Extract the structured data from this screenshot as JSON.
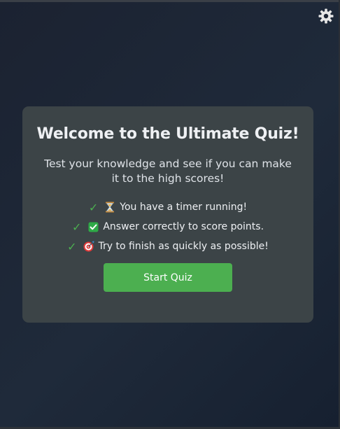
{
  "settings": {
    "icon": "gear-icon",
    "color": "#e6e6e6"
  },
  "card": {
    "title": "Welcome to the Ultimate Quiz!",
    "intro": "Test your knowledge and see if you can make it to the high scores!",
    "features": [
      {
        "icon": "hourglass-icon",
        "text": "You have a timer running!"
      },
      {
        "icon": "checkbox-icon",
        "text": "Answer correctly to score points."
      },
      {
        "icon": "target-icon",
        "text": "Try to finish as quickly as possible!"
      }
    ],
    "start_label": "Start Quiz"
  },
  "colors": {
    "background": "#1c2432",
    "card": "#3c4447",
    "accent": "#4caf50",
    "text": "#e8eaee"
  }
}
